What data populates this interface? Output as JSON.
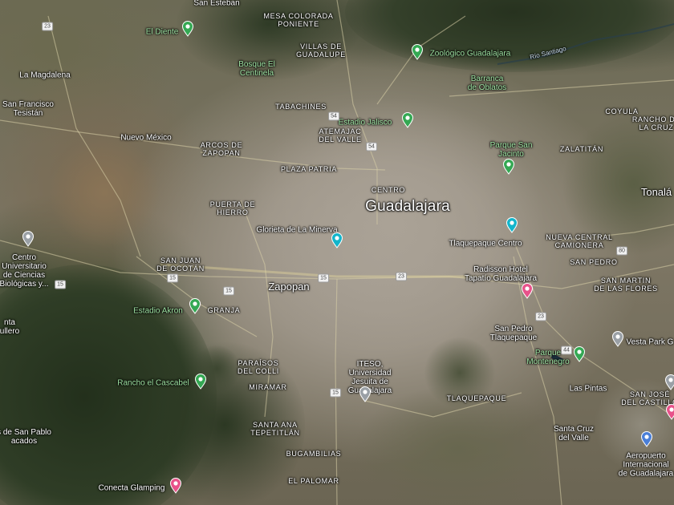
{
  "map": {
    "type": "satellite",
    "city_label": "Guadalajara",
    "colors": {
      "park_pin": "#34a853",
      "service_pin": "#12b5cb",
      "lodging_pin": "#e8528a",
      "airport_pin": "#4a7fd8",
      "generic_pin": "#9aa0a6"
    },
    "places": [
      {
        "id": "san-esteban",
        "text": "San Esteban",
        "kind": "place"
      },
      {
        "id": "el-diente",
        "text": "El Diente",
        "kind": "park"
      },
      {
        "id": "mesa-colorada",
        "text": "MESA COLORADA\nPONIENTE",
        "kind": "district"
      },
      {
        "id": "villas-guadalupe",
        "text": "VILLAS DE\nGUADALUPE",
        "kind": "district"
      },
      {
        "id": "zoologico",
        "text": "Zoológico Guadalajara",
        "kind": "park"
      },
      {
        "id": "rio-santiago",
        "text": "Río Santiago",
        "kind": "water"
      },
      {
        "id": "la-magdalena",
        "text": "La Magdalena",
        "kind": "place"
      },
      {
        "id": "bosque-centinela",
        "text": "Bosque El\nCentinela",
        "kind": "park"
      },
      {
        "id": "barranca-oblatos",
        "text": "Barranca\nde Oblatos",
        "kind": "park"
      },
      {
        "id": "san-francisco-tesistan",
        "text": "San Francisco\nTesistán",
        "kind": "place"
      },
      {
        "id": "tabachines",
        "text": "TABACHINES",
        "kind": "district"
      },
      {
        "id": "estadio-jalisco",
        "text": "Estadio Jalisco",
        "kind": "park"
      },
      {
        "id": "coyula",
        "text": "COYULA",
        "kind": "district"
      },
      {
        "id": "rancho-cruz",
        "text": "RANCHO DE\nLA CRUZ",
        "kind": "district"
      },
      {
        "id": "atemajac",
        "text": "ATEMAJAC\nDEL VALLE",
        "kind": "district"
      },
      {
        "id": "nuevo-mexico",
        "text": "Nuevo México",
        "kind": "place"
      },
      {
        "id": "arcos-zapopan",
        "text": "ARCOS DE\nZAPOPAN",
        "kind": "district"
      },
      {
        "id": "parque-san-jacinto",
        "text": "Parque San\nJacinto",
        "kind": "park"
      },
      {
        "id": "zalatitan",
        "text": "ZALATITÁN",
        "kind": "district"
      },
      {
        "id": "plaza-patria",
        "text": "PLAZA PATRIA",
        "kind": "district"
      },
      {
        "id": "centro",
        "text": "CENTRO",
        "kind": "district"
      },
      {
        "id": "tonala",
        "text": "Tonalá",
        "kind": "city"
      },
      {
        "id": "puerta-hierro",
        "text": "PUERTA DE\nHIERRO",
        "kind": "district"
      },
      {
        "id": "glorieta-minerva",
        "text": "Glorieta de La Minerva",
        "kind": "service"
      },
      {
        "id": "tlaquepaque-centro",
        "text": "Tlaquepaque Centro",
        "kind": "service"
      },
      {
        "id": "nueva-central",
        "text": "NUEVA CENTRAL\nCAMIONERA",
        "kind": "district"
      },
      {
        "id": "centro-universitario",
        "text": "Centro\nUniversitario\nde Ciencias\nBiológicas y...",
        "kind": "generic"
      },
      {
        "id": "san-juan-ocotan",
        "text": "SAN JUAN\nDE OCOTÁN",
        "kind": "district"
      },
      {
        "id": "radisson",
        "text": "Radisson Hotel\nTapatío Guadalajara",
        "kind": "lodging"
      },
      {
        "id": "san-pedro",
        "text": "SAN PEDRO",
        "kind": "district"
      },
      {
        "id": "zapopan",
        "text": "Zapopan",
        "kind": "city"
      },
      {
        "id": "san-martin",
        "text": "SAN MARTIN\nDE LAS FLORES",
        "kind": "district"
      },
      {
        "id": "estadio-akron",
        "text": "Estadio Akron",
        "kind": "park"
      },
      {
        "id": "granja",
        "text": "GRANJA",
        "kind": "district"
      },
      {
        "id": "santa-lucia",
        "text": "nta\nullero",
        "kind": "place"
      },
      {
        "id": "san-pedro-tlaquepaque",
        "text": "San Pedro\nTlaquepaque",
        "kind": "place"
      },
      {
        "id": "vesta-park",
        "text": "Vesta Park G",
        "kind": "generic"
      },
      {
        "id": "parque-montenegro",
        "text": "Parque\nMontenegro",
        "kind": "park"
      },
      {
        "id": "paraisos-colli",
        "text": "PARAÍSOS\nDEL COLLI",
        "kind": "district"
      },
      {
        "id": "iteso",
        "text": "ITESO,\nUniversidad\nJesuita de\nGuadalajara",
        "kind": "generic"
      },
      {
        "id": "rancho-cascabel",
        "text": "Rancho el Cascabel",
        "kind": "park"
      },
      {
        "id": "las-pintas",
        "text": "Las Pintas",
        "kind": "place"
      },
      {
        "id": "miramar",
        "text": "MIRAMAR",
        "kind": "district"
      },
      {
        "id": "tlaquepaque",
        "text": "TLAQUEPAQUE",
        "kind": "district"
      },
      {
        "id": "san-jose-castillo",
        "text": "SAN JOSÉ\nDEL CASTILLO",
        "kind": "district"
      },
      {
        "id": "santa-ana",
        "text": "SANTA ANA\nTEPETITLÁN",
        "kind": "district"
      },
      {
        "id": "santa-cruz-valle",
        "text": "Santa Cruz\ndel Valle",
        "kind": "place"
      },
      {
        "id": "san-pablo",
        "text": "s de San Pablo\nacados",
        "kind": "place"
      },
      {
        "id": "bugambilias",
        "text": "BUGAMBILIAS",
        "kind": "district"
      },
      {
        "id": "aeropuerto",
        "text": "Aeropuerto\nInternacional\nde Guadalajara",
        "kind": "airport"
      },
      {
        "id": "conecta-glamping",
        "text": "Conecta Glamping",
        "kind": "lodging"
      },
      {
        "id": "el-palomar",
        "text": "EL PALOMAR",
        "kind": "district"
      }
    ],
    "pins": [
      {
        "id": "el-diente-pin",
        "icon": "tree-icon",
        "kind": "park"
      },
      {
        "id": "zoologico-pin",
        "icon": "paw-icon",
        "kind": "park"
      },
      {
        "id": "estadio-jalisco-pin",
        "icon": "stadium-icon",
        "kind": "park"
      },
      {
        "id": "parque-san-jacinto-pin",
        "icon": "tree-icon",
        "kind": "park"
      },
      {
        "id": "glorieta-minerva-pin",
        "icon": "monument-icon",
        "kind": "service"
      },
      {
        "id": "tlaquepaque-centro-pin",
        "icon": "camera-icon",
        "kind": "service"
      },
      {
        "id": "centro-universitario-pin",
        "icon": "school-icon",
        "kind": "generic"
      },
      {
        "id": "radisson-pin",
        "icon": "bed-icon",
        "kind": "lodging"
      },
      {
        "id": "estadio-akron-pin",
        "icon": "stadium-icon",
        "kind": "park"
      },
      {
        "id": "parque-montenegro-pin",
        "icon": "tree-icon",
        "kind": "park"
      },
      {
        "id": "vesta-park-pin",
        "icon": "generic-icon",
        "kind": "generic"
      },
      {
        "id": "iteso-pin",
        "icon": "school-icon",
        "kind": "generic"
      },
      {
        "id": "rancho-cascabel-pin",
        "icon": "tree-icon",
        "kind": "park"
      },
      {
        "id": "aeropuerto-pin",
        "icon": "airplane-icon",
        "kind": "airport"
      },
      {
        "id": "conecta-glamping-pin",
        "icon": "bed-icon",
        "kind": "lodging"
      },
      {
        "id": "edge-pink-pin",
        "icon": "bed-icon",
        "kind": "lodging"
      },
      {
        "id": "edge-grey-pin",
        "icon": "generic-icon",
        "kind": "generic"
      }
    ],
    "road_badges": [
      {
        "id": "b23",
        "text": "23"
      },
      {
        "id": "b54a",
        "text": "54"
      },
      {
        "id": "b54b",
        "text": "54"
      },
      {
        "id": "b15a",
        "text": "15"
      },
      {
        "id": "b15b",
        "text": "15"
      },
      {
        "id": "b15c",
        "text": "15"
      },
      {
        "id": "b15d",
        "text": "15"
      },
      {
        "id": "b15e",
        "text": "15"
      },
      {
        "id": "b23b",
        "text": "23"
      },
      {
        "id": "b80",
        "text": "80"
      },
      {
        "id": "b23c",
        "text": "23"
      },
      {
        "id": "b44",
        "text": "44"
      }
    ]
  }
}
